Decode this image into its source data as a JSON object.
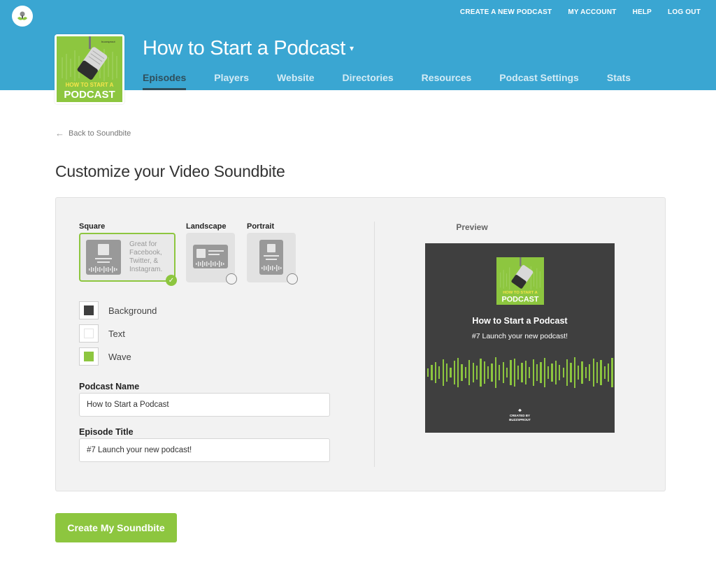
{
  "top_nav": [
    "CREATE A NEW PODCAST",
    "MY ACCOUNT",
    "HELP",
    "LOG OUT"
  ],
  "podcast": {
    "title": "How to Start a Podcast",
    "artwork_line1": "HOW TO START A",
    "artwork_line2": "PODCAST",
    "artwork_brand": "buzzsprout"
  },
  "tabs": [
    "Episodes",
    "Players",
    "Website",
    "Directories",
    "Resources",
    "Podcast Settings",
    "Stats"
  ],
  "active_tab": "Episodes",
  "back_link": "Back to Soundbite",
  "page_title": "Customize your Video Soundbite",
  "formats": {
    "square": {
      "label": "Square",
      "desc": "Great for Facebook, Twitter, & Instagram.",
      "selected": true
    },
    "landscape": {
      "label": "Landscape",
      "selected": false
    },
    "portrait": {
      "label": "Portrait",
      "selected": false
    }
  },
  "colors": {
    "background": {
      "label": "Background",
      "value": "#3f3f3f"
    },
    "text": {
      "label": "Text",
      "value": "#ffffff"
    },
    "wave": {
      "label": "Wave",
      "value": "#8dc63f"
    }
  },
  "fields": {
    "podcast_name": {
      "label": "Podcast Name",
      "value": "How to Start a Podcast"
    },
    "episode_title": {
      "label": "Episode Title",
      "value": "#7 Launch your new podcast!"
    }
  },
  "preview": {
    "label": "Preview",
    "title": "How to Start a Podcast",
    "subtitle": "#7 Launch your new podcast!",
    "credit_line1": "CREATED BY",
    "credit_line2": "BUZZSPROUT"
  },
  "create_button": "Create My Soundbite"
}
